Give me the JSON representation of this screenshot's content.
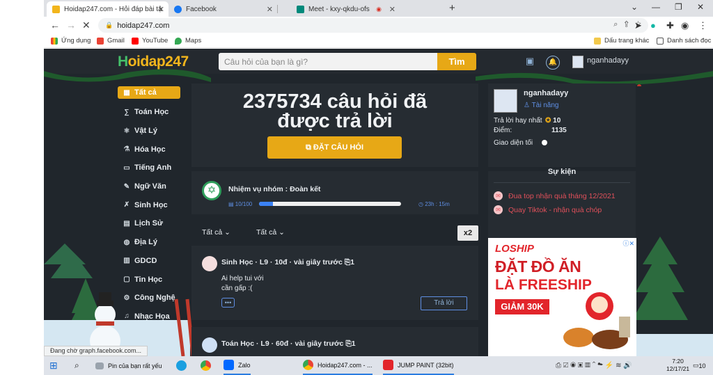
{
  "browser": {
    "tabs": [
      {
        "title": "Hoidap247.com - Hỏi đáp bài tậ",
        "active": true
      },
      {
        "title": "Facebook",
        "active": false
      },
      {
        "title": "Meet - kxy-qkdu-ofs",
        "active": false
      }
    ],
    "new_tab_label": "+",
    "url": "hoidap247.com",
    "bookmarks": [
      {
        "label": "Ứng dụng"
      },
      {
        "label": "Gmail"
      },
      {
        "label": "YouTube"
      },
      {
        "label": "Maps"
      }
    ],
    "other_bookmarks_label": "Dấu trang khác",
    "reading_list_label": "Danh sách đọc",
    "status_text": "Đang chờ graph.facebook.com..."
  },
  "site": {
    "logo_part1": "H",
    "logo_part2": "oidap247",
    "search_placeholder": "Câu hỏi của bạn là gì?",
    "search_button": "Tìm",
    "username": "nganhadayy"
  },
  "sidebar": {
    "items": [
      {
        "label": "Tất cả",
        "icon": "grid-icon",
        "active": true
      },
      {
        "label": "Toán Học",
        "icon": "math-icon"
      },
      {
        "label": "Vật Lý",
        "icon": "physics-icon"
      },
      {
        "label": "Hóa Học",
        "icon": "flask-icon"
      },
      {
        "label": "Tiếng Anh",
        "icon": "english-icon"
      },
      {
        "label": "Ngữ Văn",
        "icon": "pen-icon"
      },
      {
        "label": "Sinh Học",
        "icon": "dna-icon"
      },
      {
        "label": "Lịch Sử",
        "icon": "book-icon"
      },
      {
        "label": "Địa Lý",
        "icon": "globe-icon"
      },
      {
        "label": "GDCD",
        "icon": "civics-icon"
      },
      {
        "label": "Tin Học",
        "icon": "computer-icon"
      },
      {
        "label": "Công Nghệ",
        "icon": "gear-icon"
      },
      {
        "label": "Nhạc Họa",
        "icon": "music-icon"
      }
    ]
  },
  "hero": {
    "title_line1": "2375734 câu hỏi đã",
    "title_line2": "được trả lời",
    "ask_button": "ĐẶT CÂU HỎI"
  },
  "mission": {
    "title": "Nhiệm vụ nhóm : Đoàn kết",
    "count": "10/100",
    "progress": 0.1,
    "time": "23h : 15m"
  },
  "filters": {
    "filter1": "Tất cả",
    "filter2": "Tất cả",
    "multiplier": "x2"
  },
  "questions": [
    {
      "subject": "Sinh Học",
      "grade": "L9",
      "points": "10đ",
      "time": "vài giây trước",
      "attachments": "1",
      "text_line1": "Ai help tui với",
      "text_line2": "cần gấp :(",
      "answer_button": "Trả lời"
    },
    {
      "subject": "Toán Học",
      "grade": "L9",
      "points": "60đ",
      "time": "vài giây trước",
      "attachments": "1"
    }
  ],
  "profile": {
    "name": "nganhadayy",
    "rank": "Tài năng",
    "best_answers_label": "Trả lời hay nhất",
    "best_answers_value": "10",
    "points_label": "Điểm:",
    "points_value": "1135",
    "dark_mode_label": "Giao diện tối"
  },
  "events": {
    "title": "Sự kiện",
    "items": [
      {
        "label": "Đua top nhận quà tháng 12/2021"
      },
      {
        "label": "Quay Tiktok - nhận quà chóp"
      }
    ]
  },
  "ad": {
    "brand": "LOSHIP",
    "line1": "ĐẶT ĐỒ ĂN",
    "line2": "LÀ FREESHIP",
    "promo": "GIẢM 30K"
  },
  "taskbar": {
    "search_label": "Pin của bạn rất yếu",
    "apps": [
      {
        "label": "Zalo"
      },
      {
        "label": "Hoidap247.com - ..."
      },
      {
        "label": "JUMP PAINT (32bit)"
      }
    ],
    "time": "7:20",
    "date": "12/17/21",
    "notification_count": "10"
  },
  "colors": {
    "accent": "#e7a816",
    "page_bg": "#20262c",
    "card_bg": "#262c32",
    "link_blue": "#5f8fe4",
    "event_red": "#e0505a"
  }
}
